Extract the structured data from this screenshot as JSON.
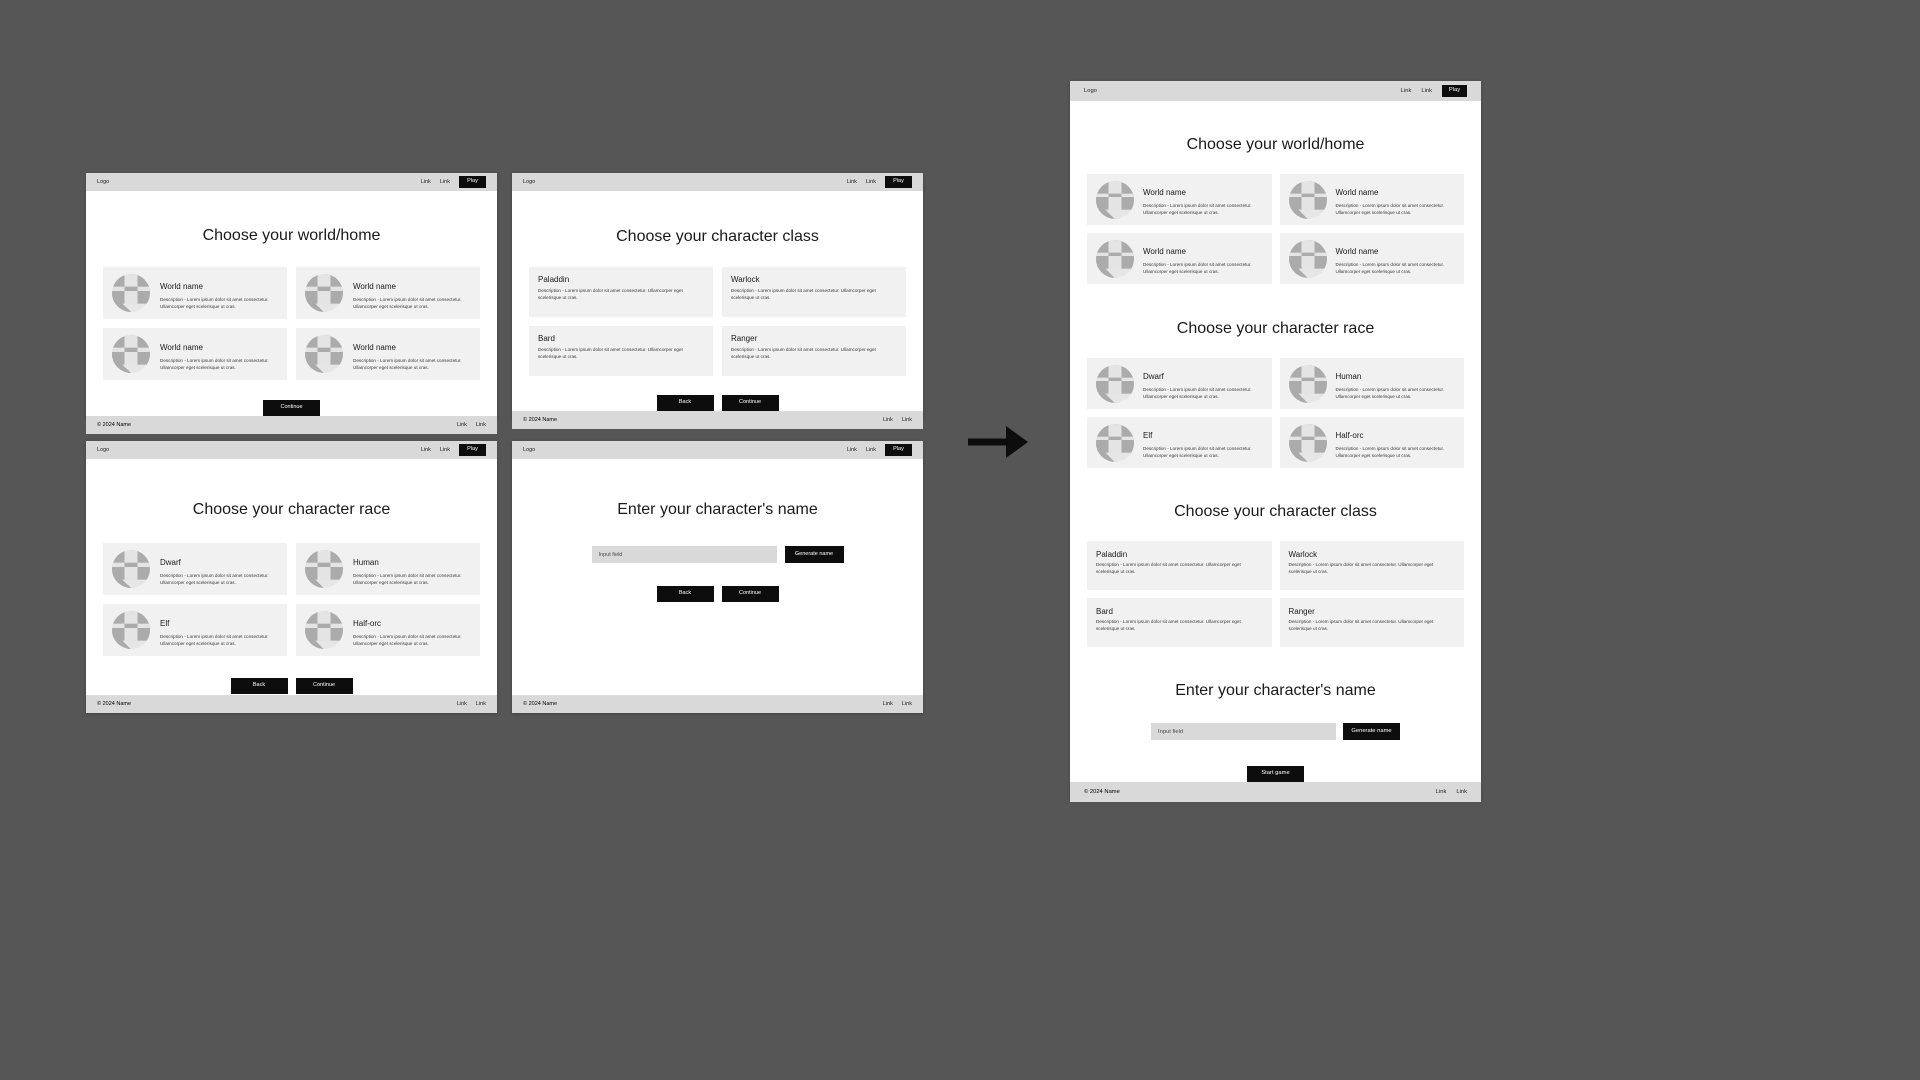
{
  "canvas": {
    "background": "#565656"
  },
  "common": {
    "logo": "Logo",
    "nav_links": [
      "Link",
      "Link"
    ],
    "play_label": "Play",
    "footer_copyright": "© 2024 Name",
    "footer_links": [
      "Link",
      "Link"
    ],
    "description": "Description - Lorem ipsum dolor sit amet consectetur. Ullamcorper eget scelerisque ut cras.",
    "colors": {
      "button": "#0d0d0d",
      "button_text": "#ffffff",
      "bar": "#d9d9d9",
      "card": "#f1f1f1",
      "page": "#ffffff"
    }
  },
  "buttons": {
    "continue": "Continue",
    "back": "Back",
    "generate_name": "Generate name",
    "start_game": "Start game"
  },
  "input": {
    "placeholder": "Input field",
    "value": "Input field"
  },
  "screens": {
    "world": {
      "title": "Choose your world/home",
      "cards": [
        {
          "name": "World name"
        },
        {
          "name": "World name"
        },
        {
          "name": "World name"
        },
        {
          "name": "World name"
        }
      ]
    },
    "class": {
      "title": "Choose your character class",
      "cards": [
        {
          "name": "Paladdin"
        },
        {
          "name": "Warlock"
        },
        {
          "name": "Bard"
        },
        {
          "name": "Ranger"
        }
      ]
    },
    "race": {
      "title": "Choose your character race",
      "cards": [
        {
          "name": "Dwarf"
        },
        {
          "name": "Human"
        },
        {
          "name": "Elf"
        },
        {
          "name": "Half-orc"
        }
      ]
    },
    "name": {
      "title": "Enter your character's name"
    }
  }
}
